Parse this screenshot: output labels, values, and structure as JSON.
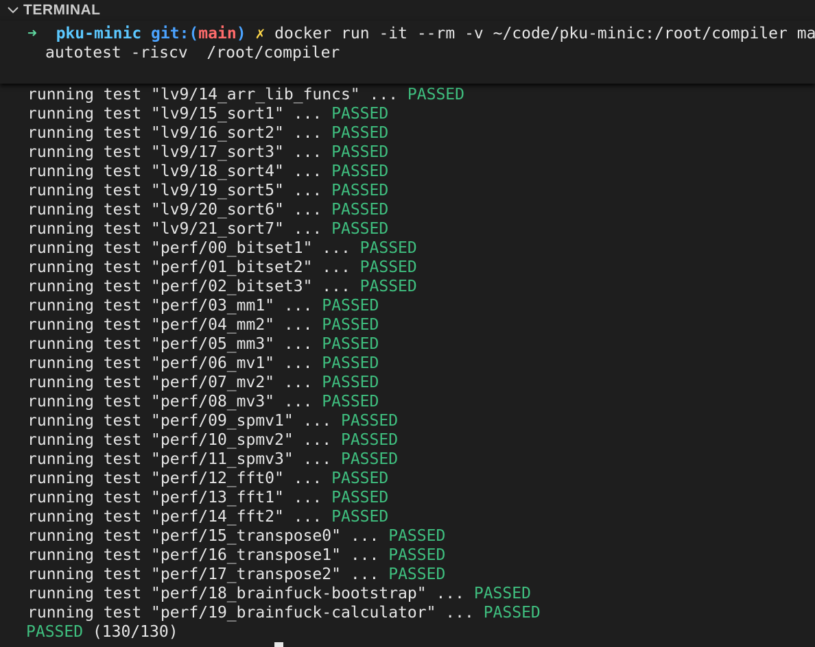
{
  "panel": {
    "title": "TERMINAL"
  },
  "prompt": {
    "arrow": "➜",
    "dir": "pku-minic",
    "git_prefix": "git:(",
    "branch": "main",
    "git_suffix": ")",
    "dirty": "✗",
    "command_line1": "docker run -it --rm -v ~/code/pku-minic:/root/compiler ma",
    "command_line2": "autotest -riscv  /root/compiler"
  },
  "tests": [
    {
      "prefix": "running test ",
      "name": "\"lv9/14_arr_lib_funcs\"",
      "dots": " ... ",
      "status": "PASSED"
    },
    {
      "prefix": "running test ",
      "name": "\"lv9/15_sort1\"",
      "dots": " ... ",
      "status": "PASSED"
    },
    {
      "prefix": "running test ",
      "name": "\"lv9/16_sort2\"",
      "dots": " ... ",
      "status": "PASSED"
    },
    {
      "prefix": "running test ",
      "name": "\"lv9/17_sort3\"",
      "dots": " ... ",
      "status": "PASSED"
    },
    {
      "prefix": "running test ",
      "name": "\"lv9/18_sort4\"",
      "dots": " ... ",
      "status": "PASSED"
    },
    {
      "prefix": "running test ",
      "name": "\"lv9/19_sort5\"",
      "dots": " ... ",
      "status": "PASSED"
    },
    {
      "prefix": "running test ",
      "name": "\"lv9/20_sort6\"",
      "dots": " ... ",
      "status": "PASSED"
    },
    {
      "prefix": "running test ",
      "name": "\"lv9/21_sort7\"",
      "dots": " ... ",
      "status": "PASSED"
    },
    {
      "prefix": "running test ",
      "name": "\"perf/00_bitset1\"",
      "dots": " ... ",
      "status": "PASSED"
    },
    {
      "prefix": "running test ",
      "name": "\"perf/01_bitset2\"",
      "dots": " ... ",
      "status": "PASSED"
    },
    {
      "prefix": "running test ",
      "name": "\"perf/02_bitset3\"",
      "dots": " ... ",
      "status": "PASSED"
    },
    {
      "prefix": "running test ",
      "name": "\"perf/03_mm1\"",
      "dots": " ... ",
      "status": "PASSED"
    },
    {
      "prefix": "running test ",
      "name": "\"perf/04_mm2\"",
      "dots": " ... ",
      "status": "PASSED"
    },
    {
      "prefix": "running test ",
      "name": "\"perf/05_mm3\"",
      "dots": " ... ",
      "status": "PASSED"
    },
    {
      "prefix": "running test ",
      "name": "\"perf/06_mv1\"",
      "dots": " ... ",
      "status": "PASSED"
    },
    {
      "prefix": "running test ",
      "name": "\"perf/07_mv2\"",
      "dots": " ... ",
      "status": "PASSED"
    },
    {
      "prefix": "running test ",
      "name": "\"perf/08_mv3\"",
      "dots": " ... ",
      "status": "PASSED"
    },
    {
      "prefix": "running test ",
      "name": "\"perf/09_spmv1\"",
      "dots": " ... ",
      "status": "PASSED"
    },
    {
      "prefix": "running test ",
      "name": "\"perf/10_spmv2\"",
      "dots": " ... ",
      "status": "PASSED"
    },
    {
      "prefix": "running test ",
      "name": "\"perf/11_spmv3\"",
      "dots": " ... ",
      "status": "PASSED"
    },
    {
      "prefix": "running test ",
      "name": "\"perf/12_fft0\"",
      "dots": " ... ",
      "status": "PASSED"
    },
    {
      "prefix": "running test ",
      "name": "\"perf/13_fft1\"",
      "dots": " ... ",
      "status": "PASSED"
    },
    {
      "prefix": "running test ",
      "name": "\"perf/14_fft2\"",
      "dots": " ... ",
      "status": "PASSED"
    },
    {
      "prefix": "running test ",
      "name": "\"perf/15_transpose0\"",
      "dots": " ... ",
      "status": "PASSED"
    },
    {
      "prefix": "running test ",
      "name": "\"perf/16_transpose1\"",
      "dots": " ... ",
      "status": "PASSED"
    },
    {
      "prefix": "running test ",
      "name": "\"perf/17_transpose2\"",
      "dots": " ... ",
      "status": "PASSED"
    },
    {
      "prefix": "running test ",
      "name": "\"perf/18_brainfuck-bootstrap\"",
      "dots": " ... ",
      "status": "PASSED"
    },
    {
      "prefix": "running test ",
      "name": "\"perf/19_brainfuck-calculator\"",
      "dots": " ... ",
      "status": "PASSED"
    }
  ],
  "summary": {
    "label": "PASSED",
    "count": " (130/130)"
  },
  "colors": {
    "background": "#1e1e1e",
    "passed": "#3fbf7f",
    "dir": "#5cc8ff",
    "branch": "#ff6b6b",
    "dirty": "#ffd84a"
  }
}
